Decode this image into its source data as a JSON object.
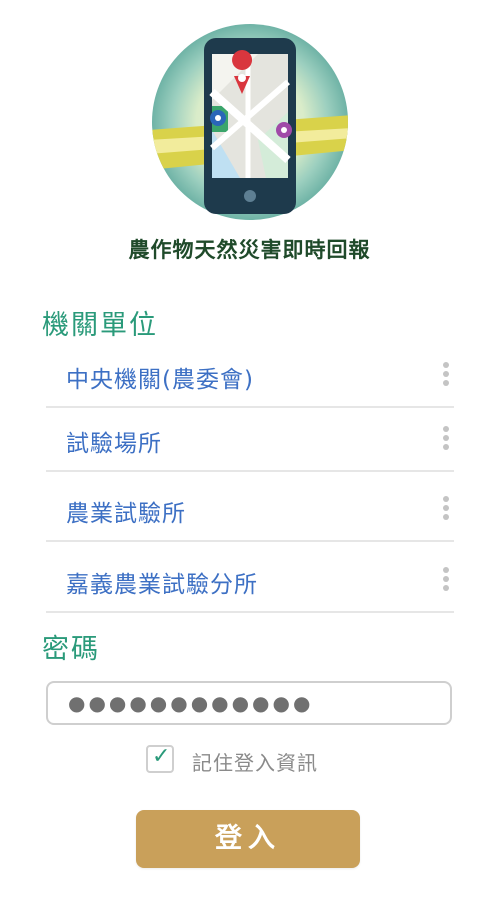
{
  "app": {
    "title": "農作物天然災害即時回報"
  },
  "unit_section": {
    "label": "機關單位",
    "selectors": [
      {
        "value": "中央機關(農委會)"
      },
      {
        "value": "試驗場所"
      },
      {
        "value": "農業試驗所"
      },
      {
        "value": "嘉義農業試驗分所"
      }
    ]
  },
  "password_section": {
    "label": "密碼",
    "masked_value": "●●●●●●●●●●●●"
  },
  "remember": {
    "checked": true,
    "check_glyph": "✓",
    "label": "記住登入資訊"
  },
  "login_button": {
    "label": "登入"
  },
  "colors": {
    "accent_green": "#2a9a7a",
    "selector_text": "#3d70c4",
    "button_gold": "#c9a05a",
    "title_dark_green": "#1f4a2a"
  },
  "icons": {
    "logo": "phone-map-pin-icon",
    "selector_menu": "kebab-menu-icon",
    "checkbox": "checkmark-icon"
  }
}
